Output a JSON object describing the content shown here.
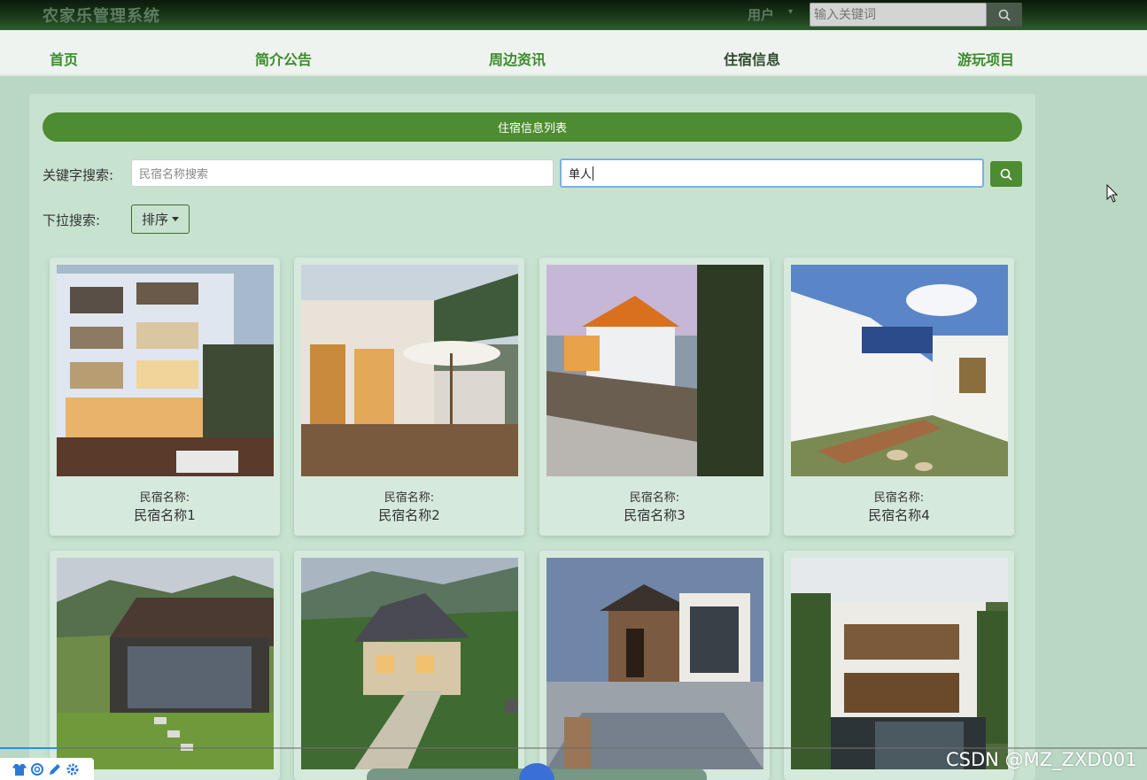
{
  "header": {
    "brand": "农家乐管理系统",
    "user_menu": "用户",
    "search_placeholder": "输入关键词"
  },
  "nav": [
    {
      "label": "首页"
    },
    {
      "label": "简介公告"
    },
    {
      "label": "周边资讯"
    },
    {
      "label": "住宿信息",
      "active": true
    },
    {
      "label": "游玩项目"
    }
  ],
  "main": {
    "title": "住宿信息列表",
    "keyword_label": "关键字搜索:",
    "name_placeholder": "民宿名称搜索",
    "type_value": "单人",
    "dropdown_label": "下拉搜索:",
    "sort_label": "排序"
  },
  "cards": [
    {
      "label": "民宿名称:",
      "name": "民宿名称1"
    },
    {
      "label": "民宿名称:",
      "name": "民宿名称2"
    },
    {
      "label": "民宿名称:",
      "name": "民宿名称3"
    },
    {
      "label": "民宿名称:",
      "name": "民宿名称4"
    },
    {
      "label": "",
      "name": ""
    },
    {
      "label": "",
      "name": ""
    },
    {
      "label": "",
      "name": ""
    },
    {
      "label": "",
      "name": ""
    }
  ],
  "watermark": "CSDN @MZ_ZXD001",
  "colors": {
    "accent": "#4d8c32",
    "nav_text": "#3b8b2b",
    "background": "#b9d7c3"
  }
}
